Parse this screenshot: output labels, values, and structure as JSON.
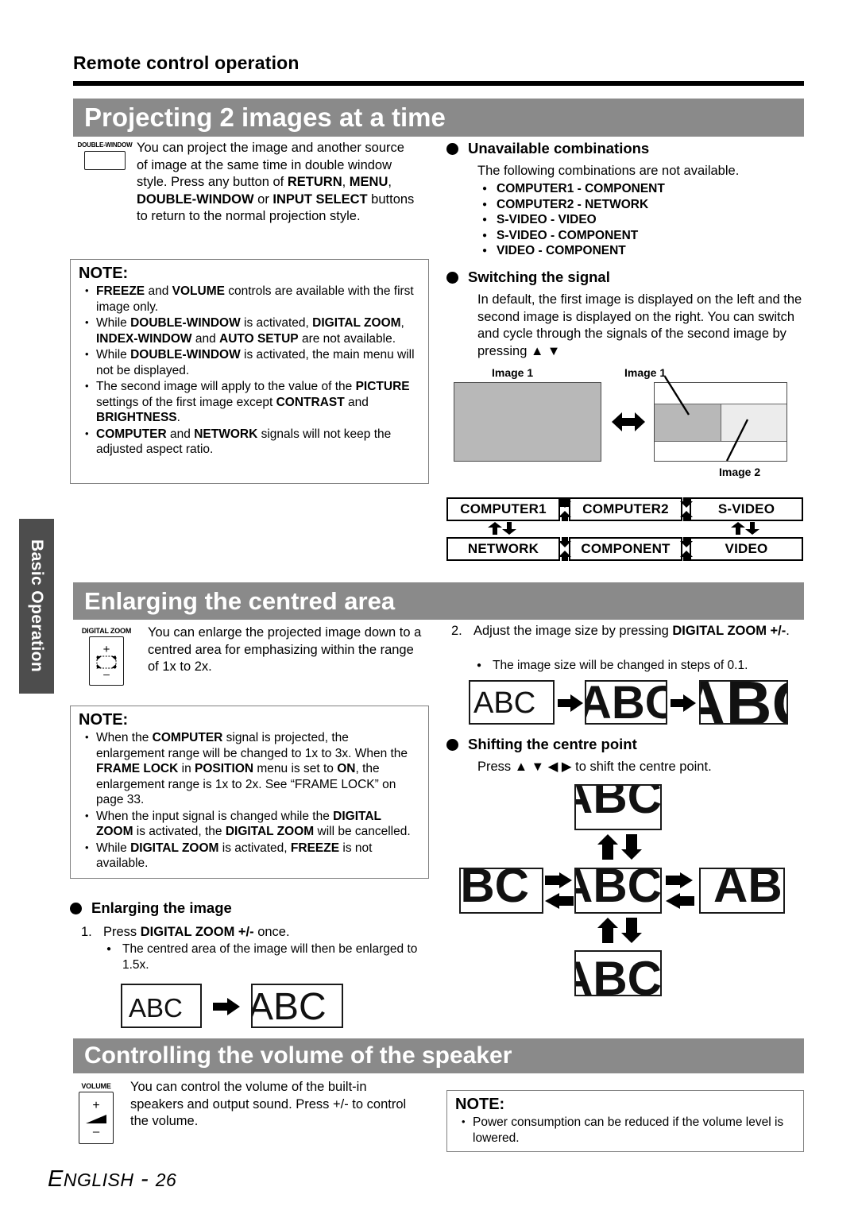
{
  "running_head": "Remote control operation",
  "side_tab": {
    "label": "Basic Operation"
  },
  "footer": {
    "language": "ENGLISH",
    "separator": " - ",
    "page": "26"
  },
  "sections": {
    "projecting": {
      "banner": "Projecting 2 images at a time",
      "remote_key": {
        "label": "DOUBLE-WINDOW",
        "icon": "double-window-key"
      },
      "intro_parts": [
        {
          "text": "You can project the image and another source of image at the same time in double window style. Press any button of ",
          "bold": false
        },
        {
          "text": "RETURN",
          "bold": true
        },
        {
          "text": ", ",
          "bold": false
        },
        {
          "text": "MENU",
          "bold": true
        },
        {
          "text": ", ",
          "bold": false
        },
        {
          "text": "DOUBLE-WINDOW",
          "bold": true
        },
        {
          "text": " or ",
          "bold": false
        },
        {
          "text": "INPUT SELECT",
          "bold": true
        },
        {
          "text": " buttons to return to the normal projection style.",
          "bold": false
        }
      ],
      "note": {
        "title": "NOTE:",
        "items": [
          [
            {
              "t": "FREEZE",
              "b": true
            },
            {
              "t": " and ",
              "b": false
            },
            {
              "t": "VOLUME",
              "b": true
            },
            {
              "t": " controls are available with the first image only.",
              "b": false
            }
          ],
          [
            {
              "t": "While ",
              "b": false
            },
            {
              "t": "DOUBLE-WINDOW",
              "b": true
            },
            {
              "t": " is activated, ",
              "b": false
            },
            {
              "t": "DIGITAL ZOOM",
              "b": true
            },
            {
              "t": ", ",
              "b": false
            },
            {
              "t": "INDEX-WINDOW",
              "b": true
            },
            {
              "t": " and ",
              "b": false
            },
            {
              "t": "AUTO SETUP",
              "b": true
            },
            {
              "t": " are not available.",
              "b": false
            }
          ],
          [
            {
              "t": "While ",
              "b": false
            },
            {
              "t": "DOUBLE-WINDOW",
              "b": true
            },
            {
              "t": " is activated, the main menu will not be displayed.",
              "b": false
            }
          ],
          [
            {
              "t": "The second image will apply to the value of the ",
              "b": false
            },
            {
              "t": "PICTURE",
              "b": true
            },
            {
              "t": " settings of the first image except ",
              "b": false
            },
            {
              "t": "CONTRAST",
              "b": true
            },
            {
              "t": " and ",
              "b": false
            },
            {
              "t": "BRIGHTNESS",
              "b": true
            },
            {
              "t": ".",
              "b": false
            }
          ],
          [
            {
              "t": "COMPUTER",
              "b": true
            },
            {
              "t": " and ",
              "b": false
            },
            {
              "t": "NETWORK",
              "b": true
            },
            {
              "t": " signals will not keep the adjusted aspect ratio.",
              "b": false
            }
          ]
        ]
      },
      "unavailable": {
        "heading": "Unavailable combinations",
        "lead": "The following combinations are not available.",
        "items": [
          "COMPUTER1 - COMPONENT",
          "COMPUTER2 - NETWORK",
          "S-VIDEO - VIDEO",
          "S-VIDEO - COMPONENT",
          "VIDEO - COMPONENT"
        ]
      },
      "switching": {
        "heading": "Switching the signal",
        "body": "In default, the first image is displayed on the left and the second image is displayed on the right. You can switch and cycle through the signals of the second image by pressing ▲ ▼",
        "diagram": {
          "label_left": "Image 1",
          "label_right_top": "Image 1",
          "label_right_bottom": "Image 2"
        },
        "signal_boxes": [
          [
            "COMPUTER1",
            "COMPUTER2",
            "S-VIDEO"
          ],
          [
            "NETWORK",
            "COMPONENT",
            "VIDEO"
          ]
        ]
      }
    },
    "enlarging": {
      "banner": "Enlarging the centred area",
      "remote_key": {
        "label": "DIGITAL ZOOM",
        "icon": "digital-zoom-key"
      },
      "intro": "You can enlarge the projected image down to a centred area for emphasizing within the range of 1x to 2x.",
      "note": {
        "title": "NOTE:",
        "items": [
          [
            {
              "t": "When the ",
              "b": false
            },
            {
              "t": "COMPUTER",
              "b": true
            },
            {
              "t": " signal is projected, the enlargement range will be changed to 1x to 3x. When the ",
              "b": false
            },
            {
              "t": "FRAME LOCK",
              "b": true
            },
            {
              "t": " in ",
              "b": false
            },
            {
              "t": "POSITION",
              "b": true
            },
            {
              "t": " menu is set to ",
              "b": false
            },
            {
              "t": "ON",
              "b": true
            },
            {
              "t": ", the enlargement range is 1x to 2x. See “FRAME LOCK” on page 33.",
              "b": false
            }
          ],
          [
            {
              "t": "When the input signal is changed while the ",
              "b": false
            },
            {
              "t": "DIGITAL ZOOM",
              "b": true
            },
            {
              "t": " is activated, the ",
              "b": false
            },
            {
              "t": "DIGITAL ZOOM",
              "b": true
            },
            {
              "t": " will be cancelled.",
              "b": false
            }
          ],
          [
            {
              "t": "While ",
              "b": false
            },
            {
              "t": "DIGITAL ZOOM",
              "b": true
            },
            {
              "t": " is activated, ",
              "b": false
            },
            {
              "t": "FREEZE",
              "b": true
            },
            {
              "t": " is not available.",
              "b": false
            }
          ]
        ]
      },
      "enlarging_image": {
        "heading": "Enlarging the image",
        "step_num": "1.",
        "step_parts": [
          {
            "t": "Press ",
            "b": false
          },
          {
            "t": "DIGITAL ZOOM +/-",
            "b": true
          },
          {
            "t": " once.",
            "b": false
          }
        ],
        "sub": "The centred area of the image will then be enlarged to 1.5x."
      },
      "step2": {
        "num": "2.",
        "parts": [
          {
            "t": "Adjust the image size by pressing ",
            "b": false
          },
          {
            "t": "DIGITAL ZOOM +/-",
            "b": true
          },
          {
            "t": ".",
            "b": false
          }
        ],
        "sub": "The image size will be changed in steps of 0.1."
      },
      "shifting": {
        "heading": "Shifting the centre point",
        "body": "Press ▲ ▼ ◀ ▶ to shift the centre point."
      },
      "abc_text": "ABC"
    },
    "volume": {
      "banner": "Controlling the volume of the speaker",
      "remote_key": {
        "label": "VOLUME",
        "icon": "volume-key"
      },
      "intro": "You can control the volume of the built-in speakers and output sound. Press +/- to control the volume.",
      "note": {
        "title": "NOTE:",
        "items": [
          [
            {
              "t": "Power consumption can be reduced if the volume level is lowered.",
              "b": false
            }
          ]
        ]
      }
    }
  },
  "colors": {
    "banner_bg": "#8a8a8a",
    "side_tab_bg": "#4d4d4d",
    "note_border": "#808080",
    "screen_fill": "#b8b8b8",
    "screen_fill_light": "#ececec"
  }
}
